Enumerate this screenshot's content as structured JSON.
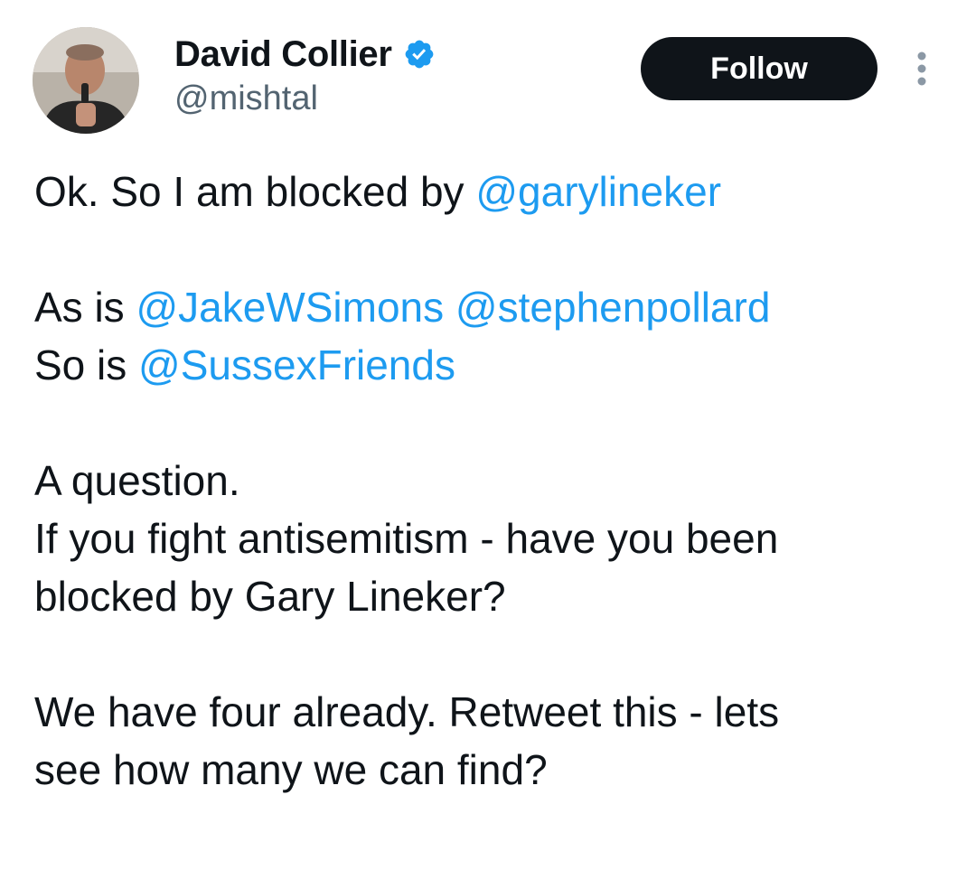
{
  "author": {
    "display_name": "David Collier",
    "handle": "@mishtal",
    "verified_icon": "verified-badge-icon",
    "verified_color": "#1d9bf0"
  },
  "actions": {
    "follow_label": "Follow",
    "more_icon": "more-vertical-icon"
  },
  "tweet": {
    "p1": {
      "text1": "Ok. So I am blocked by ",
      "mention1": "@garylineker"
    },
    "p2": {
      "l1_text": "As is ",
      "l1_mention1": "@JakeWSimons",
      "l1_mention2": "@stephenpollard",
      "l2_text": "So is ",
      "l2_mention": "@SussexFriends"
    },
    "p3": {
      "l1": "A question.",
      "l2": "If you fight antisemitism - have you been",
      "l3": "blocked by Gary Lineker?"
    },
    "p4": {
      "l1": "We have four already. Retweet this - lets",
      "l2": "see how many we can find?"
    }
  },
  "colors": {
    "link": "#1d9bf0",
    "text": "#0f1419",
    "secondary": "#536471",
    "button_bg": "#0f1419"
  }
}
